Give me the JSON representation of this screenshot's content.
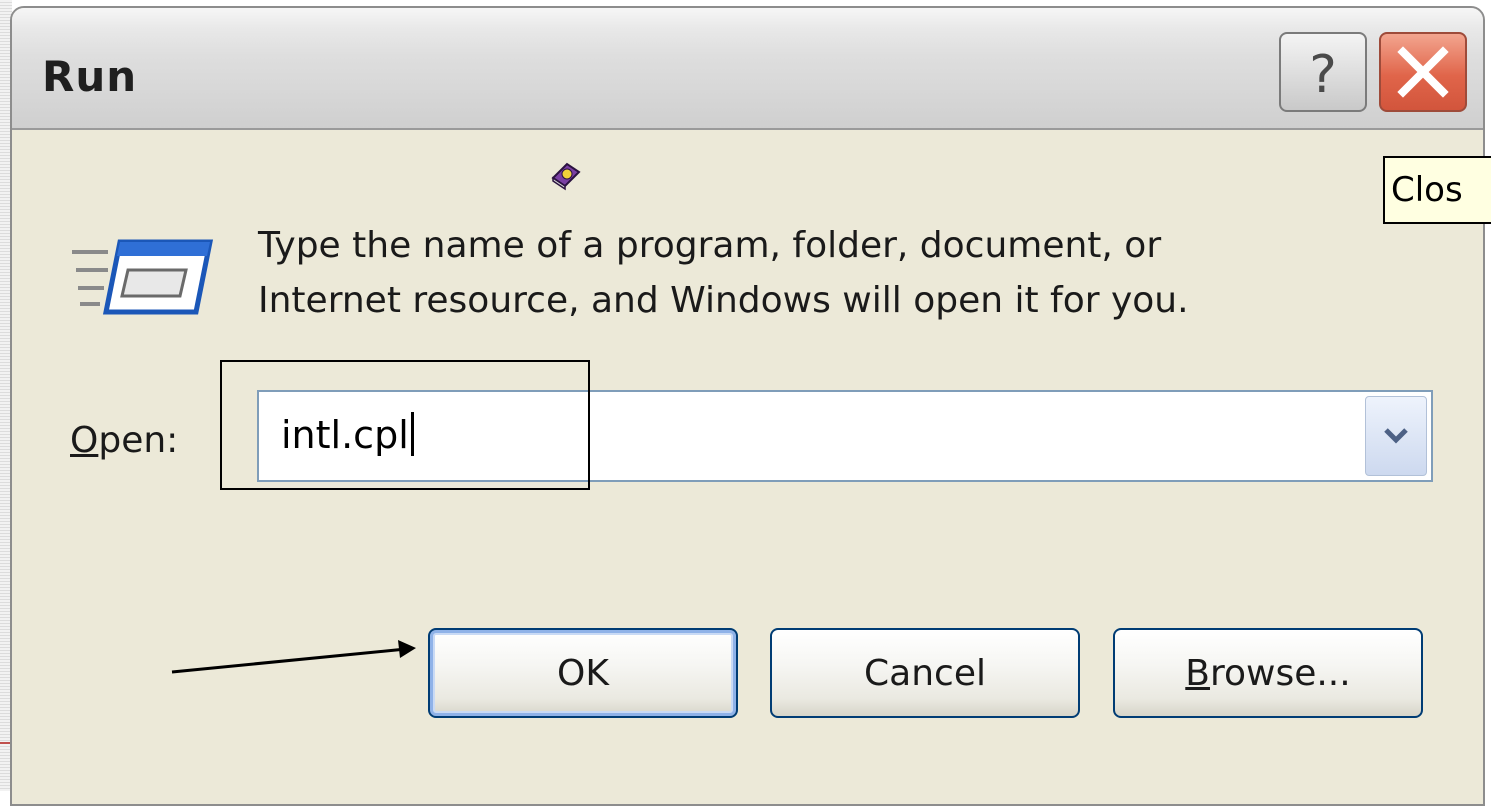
{
  "window": {
    "title": "Run",
    "help_symbol": "?",
    "tooltip": "Clos"
  },
  "content": {
    "description_line1": "Type the name of a program, folder, document, or",
    "description_line2": "Internet resource, and Windows will open it for you.",
    "open_label_access_key": "O",
    "open_label_rest": "pen:",
    "open_value": "intl.cpl"
  },
  "buttons": {
    "ok": "OK",
    "cancel": "Cancel",
    "browse_access_key": "B",
    "browse_rest": "rowse..."
  },
  "icons": {
    "title_help": "question-mark-icon",
    "title_close": "close-x-icon",
    "run": "run-window-icon",
    "help_book": "help-book-icon",
    "dropdown": "chevron-down-icon"
  },
  "colors": {
    "dialog_bg": "#ece9d8",
    "close_red": "#e0654a",
    "button_border": "#003c74",
    "tooltip_bg": "#ffffe1"
  }
}
